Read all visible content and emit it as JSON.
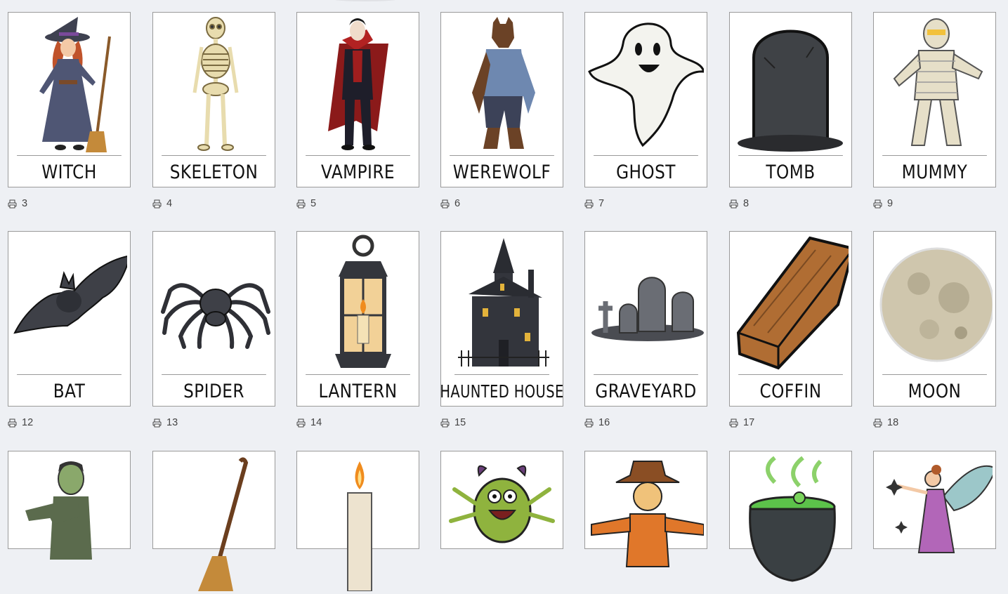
{
  "rows": [
    {
      "cards": [
        {
          "label": "WITCH",
          "icon": "witch-icon",
          "count": "3"
        },
        {
          "label": "SKELETON",
          "icon": "skeleton-icon",
          "count": "4"
        },
        {
          "label": "VAMPIRE",
          "icon": "vampire-icon",
          "count": "5"
        },
        {
          "label": "WEREWOLF",
          "icon": "werewolf-icon",
          "count": "6"
        },
        {
          "label": "GHOST",
          "icon": "ghost-icon",
          "count": "7"
        },
        {
          "label": "TOMB",
          "icon": "tombstone-icon",
          "count": "8"
        },
        {
          "label": "MUMMY",
          "icon": "mummy-icon",
          "count": "9"
        }
      ]
    },
    {
      "cards": [
        {
          "label": "BAT",
          "icon": "bat-icon",
          "count": "12"
        },
        {
          "label": "SPIDER",
          "icon": "spider-icon",
          "count": "13"
        },
        {
          "label": "LANTERN",
          "icon": "lantern-icon",
          "count": "14"
        },
        {
          "label": "HAUNTED HOUSE",
          "icon": "haunted-house-icon",
          "count": "15"
        },
        {
          "label": "GRAVEYARD",
          "icon": "graveyard-icon",
          "count": "16"
        },
        {
          "label": "COFFIN",
          "icon": "coffin-icon",
          "count": "17"
        },
        {
          "label": "MOON",
          "icon": "moon-icon",
          "count": "18"
        }
      ]
    },
    {
      "cards": [
        {
          "label": "",
          "icon": "zombie-icon"
        },
        {
          "label": "",
          "icon": "broom-icon"
        },
        {
          "label": "",
          "icon": "candle-icon"
        },
        {
          "label": "",
          "icon": "monster-icon"
        },
        {
          "label": "",
          "icon": "scarecrow-icon"
        },
        {
          "label": "",
          "icon": "cauldron-icon"
        },
        {
          "label": "",
          "icon": "fairy-icon"
        }
      ]
    }
  ],
  "count_icon": "print-icon",
  "colors": {
    "background": "#eef0f4",
    "card_border": "#9a9a9a",
    "label_text": "#111111",
    "meta_text": "#444444"
  }
}
